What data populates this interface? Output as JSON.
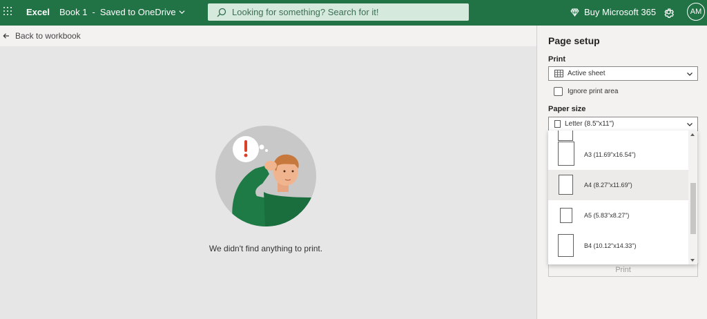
{
  "topbar": {
    "app_name": "Excel",
    "doc_name": "Book 1",
    "doc_separator": "-",
    "doc_status": "Saved to OneDrive",
    "search_placeholder": "Looking for something? Search for it!",
    "buy_label": "Buy Microsoft 365",
    "avatar_initials": "AM"
  },
  "backbar": {
    "label": "Back to workbook"
  },
  "main": {
    "empty_message": "We didn't find anything to print."
  },
  "pane": {
    "title": "Page setup",
    "print_label": "Print",
    "print_value": "Active sheet",
    "ignore_print_area_label": "Ignore print area",
    "ignore_print_area_checked": false,
    "paper_size_label": "Paper size",
    "paper_size_value": "Letter (8.5\"x11\")",
    "print_button": "Print"
  },
  "paper_options": [
    {
      "label": "A3 (11.69\"x16.54\")",
      "selected": false
    },
    {
      "label": "A4 (8.27\"x11.69\")",
      "selected": true
    },
    {
      "label": "A5 (5.83\"x8.27\")",
      "selected": false
    },
    {
      "label": "B4 (10.12\"x14.33\")",
      "selected": false
    }
  ],
  "colors": {
    "brand": "#217346",
    "illustration_shirt": "#1e7b45",
    "alert": "#d9412b"
  }
}
